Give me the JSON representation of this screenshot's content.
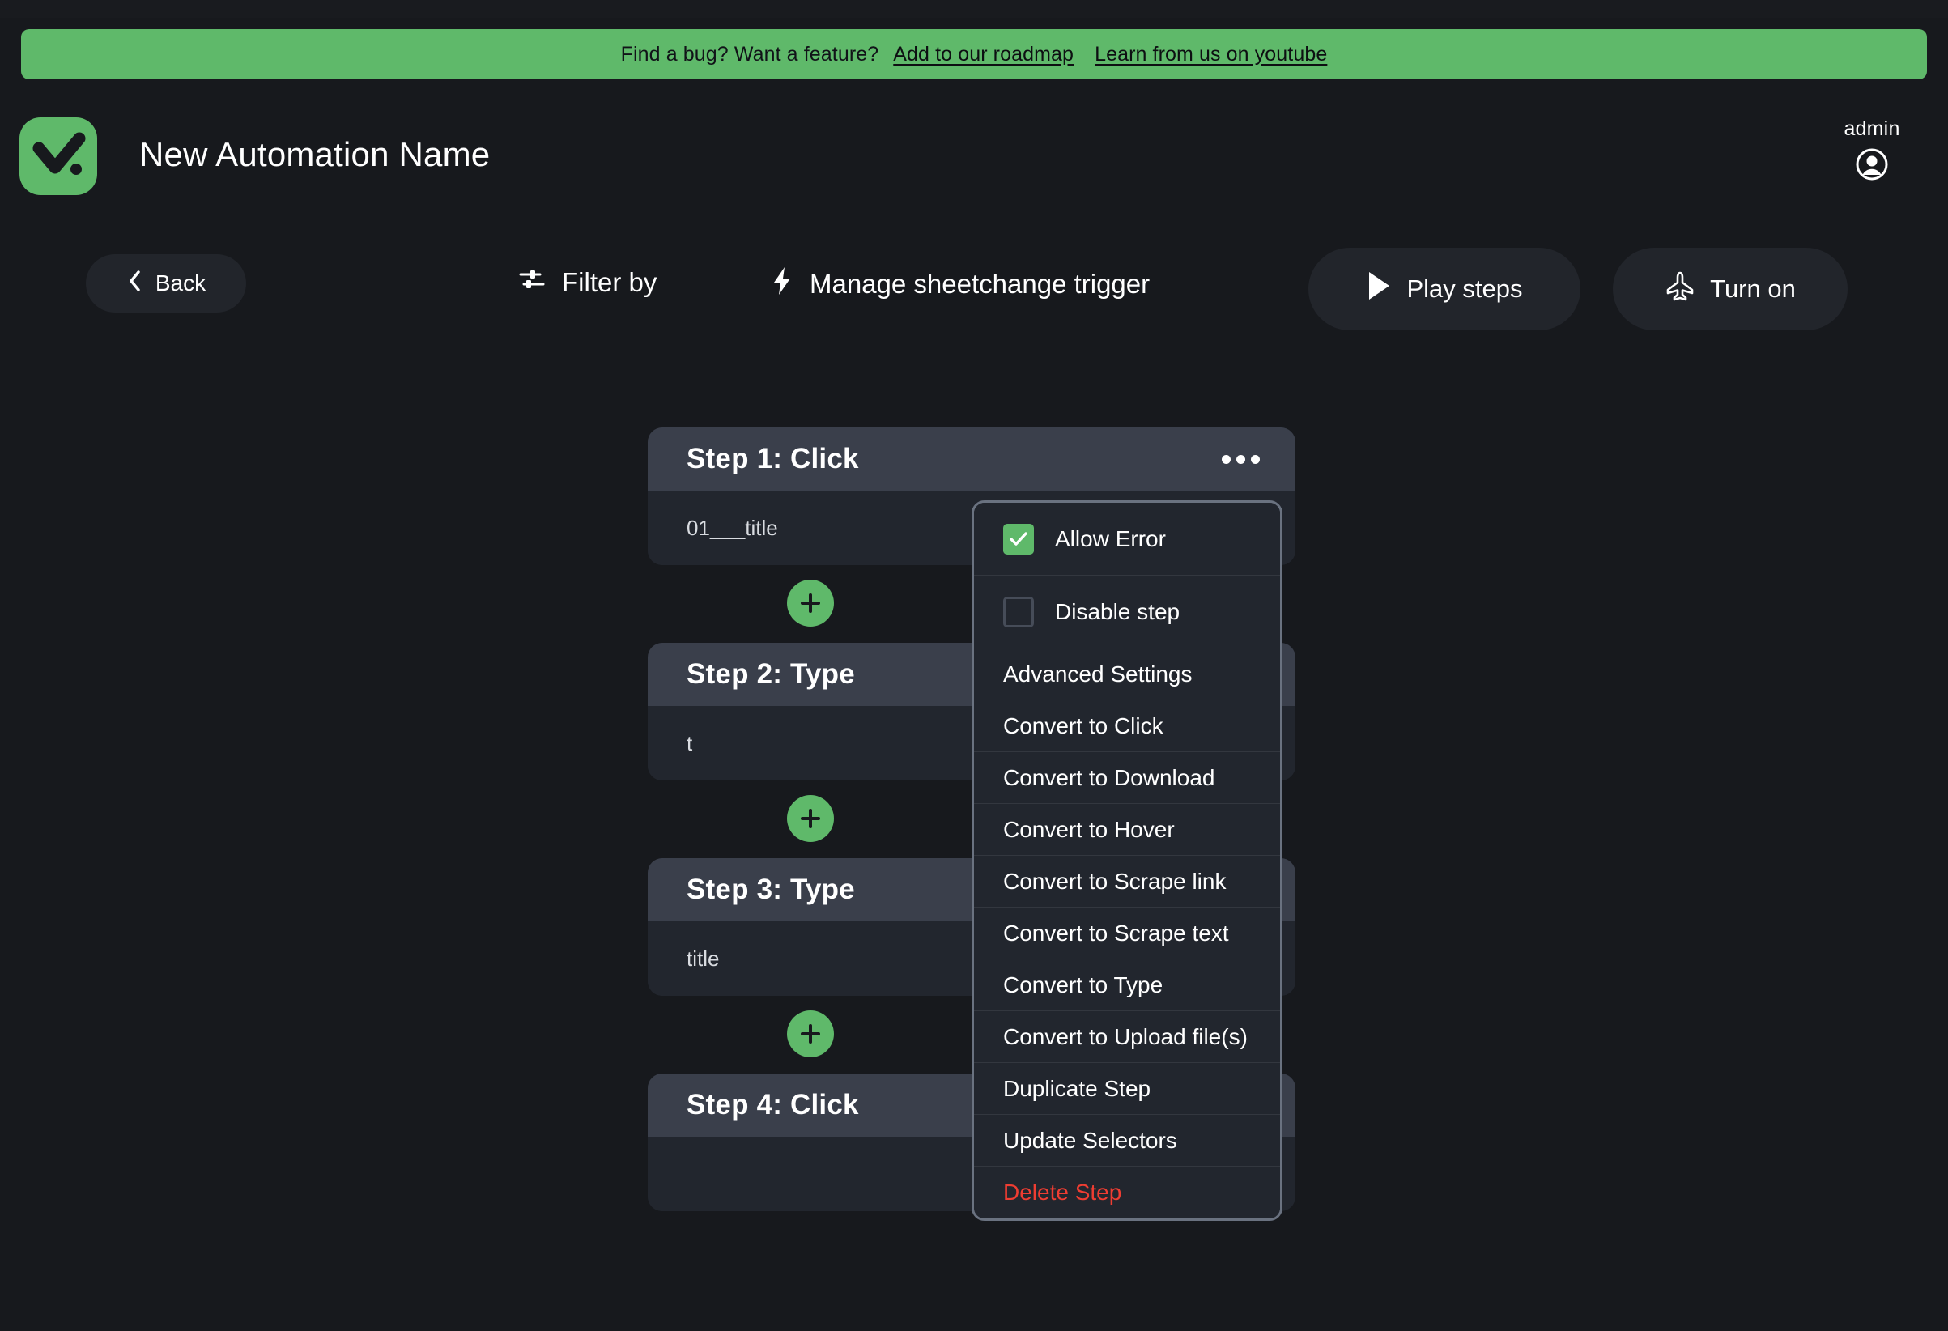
{
  "banner": {
    "prompt": "Find a bug? Want a feature?",
    "links": [
      {
        "label": "Add to our roadmap"
      },
      {
        "label": "Learn from us on youtube"
      }
    ]
  },
  "header": {
    "title": "New Automation Name",
    "account_name": "admin",
    "logo_icon": "checkmark-logo-icon",
    "avatar_icon": "user-circle-icon",
    "brand_green": "#5fb96a"
  },
  "toolbar": {
    "back_label": "Back",
    "back_icon": "chevron-left-icon",
    "filter_label": "Filter by",
    "filter_icon": "sliders-icon",
    "trigger_label": "Manage sheetchange trigger",
    "trigger_icon": "lightning-bolt-icon",
    "play_label": "Play steps",
    "play_icon": "play-triangle-icon",
    "turnon_label": "Turn on",
    "turnon_icon": "paper-plane-icon"
  },
  "steps": [
    {
      "title": "Step 1: Click",
      "value": "01___title",
      "menu_icon": "ellipsis-icon"
    },
    {
      "title": "Step 2: Type",
      "value": "t",
      "menu_icon": "ellipsis-icon"
    },
    {
      "title": "Step 3: Type",
      "value": "title",
      "menu_icon": "ellipsis-icon"
    },
    {
      "title": "Step 4: Click",
      "value": "",
      "menu_icon": "ellipsis-icon"
    }
  ],
  "add_step_icon": "plus-icon",
  "context_menu": {
    "checkboxes": [
      {
        "label": "Allow Error",
        "checked": true
      },
      {
        "label": "Disable step",
        "checked": false
      }
    ],
    "items": [
      {
        "label": "Advanced Settings",
        "danger": false
      },
      {
        "label": "Convert to Click",
        "danger": false
      },
      {
        "label": "Convert to Download",
        "danger": false
      },
      {
        "label": "Convert to Hover",
        "danger": false
      },
      {
        "label": "Convert to Scrape link",
        "danger": false
      },
      {
        "label": "Convert to Scrape text",
        "danger": false
      },
      {
        "label": "Convert to Type",
        "danger": false
      },
      {
        "label": "Convert to Upload file(s)",
        "danger": false
      },
      {
        "label": "Duplicate Step",
        "danger": false
      },
      {
        "label": "Update Selectors",
        "danger": false
      },
      {
        "label": "Delete Step",
        "danger": true
      }
    ],
    "danger_color": "#ef3d32"
  }
}
